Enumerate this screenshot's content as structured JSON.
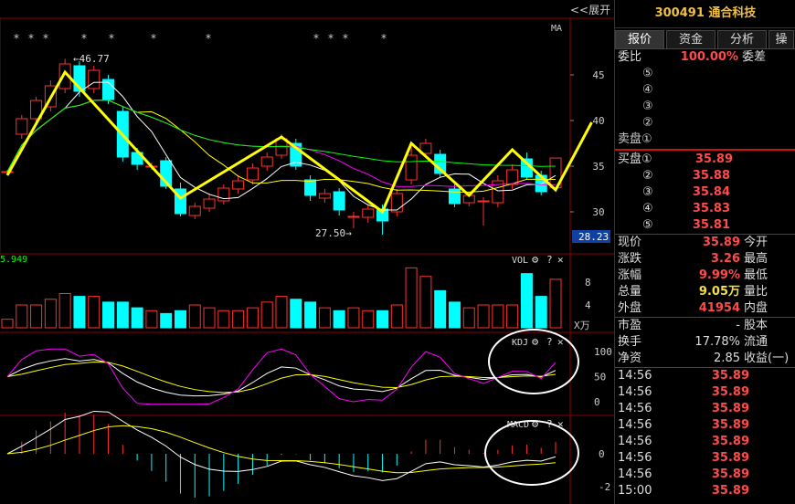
{
  "header": {
    "code_name": "300491 通合科技",
    "expand_label": "<<展开"
  },
  "tabs": [
    "报价",
    "资金",
    "分析",
    "操"
  ],
  "ask_bid_label": {
    "ratio": "委比",
    "ratio_value": "100.00%",
    "diff": "委差"
  },
  "sell_orders": [
    "⑤",
    "④",
    "③",
    "②",
    "卖盘①"
  ],
  "buy_orders": [
    {
      "label": "买盘①",
      "price": "35.89"
    },
    {
      "label": "②",
      "price": "35.88"
    },
    {
      "label": "③",
      "price": "35.84"
    },
    {
      "label": "④",
      "price": "35.83"
    },
    {
      "label": "⑤",
      "price": "35.81"
    }
  ],
  "quote": [
    {
      "l1": "现价",
      "v": "35.89",
      "l2": "今开"
    },
    {
      "l1": "涨跌",
      "v": "3.26",
      "l2": "最高"
    },
    {
      "l1": "涨幅",
      "v": "9.99%",
      "l2": "最低"
    },
    {
      "l1": "总量",
      "v": "9.05万",
      "l2": "量比"
    },
    {
      "l1": "外盘",
      "v": "41954",
      "l2": "内盘"
    }
  ],
  "fund": [
    {
      "l1": "市盈",
      "v": "-",
      "l2": "股本"
    },
    {
      "l1": "换手",
      "v": "17.78%",
      "l2": "流通"
    },
    {
      "l1": "净资",
      "v": "2.85",
      "l2": "收益(一)"
    }
  ],
  "ticks": [
    {
      "time": "14:56",
      "price": "35.89"
    },
    {
      "time": "14:56",
      "price": "35.89"
    },
    {
      "time": "14:56",
      "price": "35.89"
    },
    {
      "time": "14:56",
      "price": "35.89"
    },
    {
      "time": "14:56",
      "price": "35.89"
    },
    {
      "time": "14:56",
      "price": "35.89"
    },
    {
      "time": "14:56",
      "price": "35.89"
    },
    {
      "time": "15:00",
      "price": "35.89"
    }
  ],
  "panels": {
    "ma_label": "MA",
    "vol_label": "VOL",
    "vol_value": "5.949",
    "kdj_label": "KDJ",
    "macd_label": "MACD",
    "vol_unit": "X万",
    "high_mark": "←46.77",
    "low_mark": "27.50→",
    "price_tag": "28.23",
    "help": "?",
    "close": "✕"
  },
  "chart_data": {
    "type": "candlestick",
    "price_axis": [
      45,
      40,
      35,
      30
    ],
    "vol_axis": [
      8,
      4
    ],
    "kdj_axis": [
      100,
      50,
      0
    ],
    "macd_axis": [
      0,
      -2
    ],
    "high": 46.77,
    "low": 27.5,
    "candles": [
      {
        "o": 34.4,
        "c": 34.4,
        "h": 34.6,
        "l": 34.2
      },
      {
        "o": 38.5,
        "c": 40.2,
        "h": 40.6,
        "l": 38.0
      },
      {
        "o": 40.2,
        "c": 42.2,
        "h": 42.6,
        "l": 39.8
      },
      {
        "o": 41.5,
        "c": 43.8,
        "h": 44.4,
        "l": 41.0
      },
      {
        "o": 43.5,
        "c": 46.2,
        "h": 46.77,
        "l": 43.0
      },
      {
        "o": 46.0,
        "c": 43.2,
        "h": 46.5,
        "l": 42.6
      },
      {
        "o": 43.5,
        "c": 45.5,
        "h": 46.0,
        "l": 43.0
      },
      {
        "o": 44.5,
        "c": 42.3,
        "h": 45.0,
        "l": 41.8
      },
      {
        "o": 41.0,
        "c": 36.0,
        "h": 41.6,
        "l": 35.5
      },
      {
        "o": 36.5,
        "c": 35.2,
        "h": 37.0,
        "l": 34.6
      },
      {
        "o": 35.0,
        "c": 35.0,
        "h": 35.4,
        "l": 34.6
      },
      {
        "o": 35.6,
        "c": 32.8,
        "h": 36.0,
        "l": 32.5
      },
      {
        "o": 32.5,
        "c": 29.8,
        "h": 33.2,
        "l": 29.5
      },
      {
        "o": 29.6,
        "c": 30.6,
        "h": 31.0,
        "l": 29.2
      },
      {
        "o": 30.4,
        "c": 31.4,
        "h": 32.0,
        "l": 30.0
      },
      {
        "o": 31.2,
        "c": 32.6,
        "h": 33.0,
        "l": 30.8
      },
      {
        "o": 32.5,
        "c": 33.4,
        "h": 34.0,
        "l": 32.0
      },
      {
        "o": 33.5,
        "c": 34.8,
        "h": 35.3,
        "l": 33.0
      },
      {
        "o": 35.0,
        "c": 36.0,
        "h": 36.5,
        "l": 34.5
      },
      {
        "o": 36.2,
        "c": 38.0,
        "h": 38.5,
        "l": 35.8
      },
      {
        "o": 37.5,
        "c": 35.0,
        "h": 38.0,
        "l": 34.6
      },
      {
        "o": 33.5,
        "c": 31.8,
        "h": 34.0,
        "l": 31.2
      },
      {
        "o": 31.5,
        "c": 32.0,
        "h": 32.5,
        "l": 31.0
      },
      {
        "o": 32.2,
        "c": 30.2,
        "h": 32.6,
        "l": 29.6
      },
      {
        "o": 29.5,
        "c": 29.5,
        "h": 30.0,
        "l": 28.2
      },
      {
        "o": 29.4,
        "c": 30.3,
        "h": 30.8,
        "l": 28.8
      },
      {
        "o": 30.3,
        "c": 29.0,
        "h": 30.8,
        "l": 27.5
      },
      {
        "o": 30.0,
        "c": 32.0,
        "h": 32.5,
        "l": 29.5
      },
      {
        "o": 33.5,
        "c": 36.2,
        "h": 37.5,
        "l": 33.0
      },
      {
        "o": 36.4,
        "c": 37.5,
        "h": 38.0,
        "l": 36.0
      },
      {
        "o": 36.3,
        "c": 34.2,
        "h": 36.8,
        "l": 33.8
      },
      {
        "o": 32.5,
        "c": 30.9,
        "h": 33.0,
        "l": 30.5
      },
      {
        "o": 31.0,
        "c": 31.8,
        "h": 32.2,
        "l": 30.6
      },
      {
        "o": 31.2,
        "c": 31.2,
        "h": 31.6,
        "l": 28.5
      },
      {
        "o": 31.0,
        "c": 33.4,
        "h": 34.0,
        "l": 30.5
      },
      {
        "o": 33.0,
        "c": 34.6,
        "h": 35.2,
        "l": 32.5
      },
      {
        "o": 35.8,
        "c": 33.8,
        "h": 36.5,
        "l": 33.5
      },
      {
        "o": 34.0,
        "c": 32.2,
        "h": 34.5,
        "l": 31.8
      },
      {
        "o": 32.63,
        "c": 35.89,
        "h": 35.89,
        "l": 32.4
      }
    ],
    "volumes": [
      1.5,
      4.0,
      4.0,
      5.0,
      6.0,
      5.5,
      5.5,
      4.5,
      4.5,
      3.5,
      3.0,
      2.5,
      3.0,
      4.0,
      3.5,
      3.0,
      3.0,
      3.5,
      4.5,
      5.5,
      5.0,
      4.5,
      3.5,
      3.0,
      3.5,
      3.0,
      3.0,
      4.0,
      10.5,
      9.0,
      6.5,
      4.5,
      3.5,
      4.0,
      4.0,
      4.0,
      9.5,
      5.5,
      8.5
    ]
  }
}
